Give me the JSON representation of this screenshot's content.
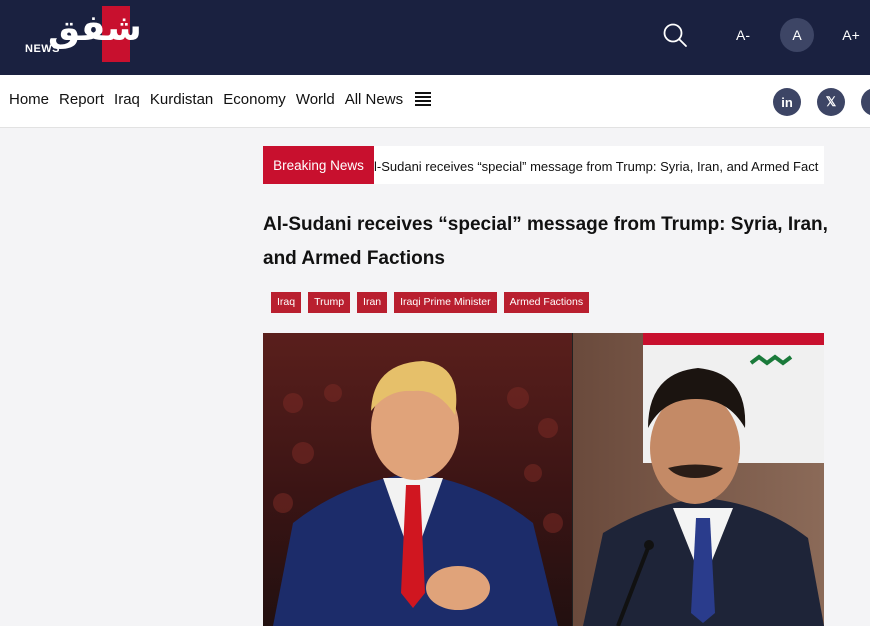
{
  "header": {
    "logo_text": "شفق",
    "logo_sub": "NEWS",
    "font_controls": [
      "A-",
      "A",
      "A+"
    ],
    "icons": {
      "search": "search-icon"
    }
  },
  "nav": {
    "items": [
      "Home",
      "Report",
      "Iraq",
      "Kurdistan",
      "Economy",
      "World",
      "All News"
    ],
    "menu_icon": "menu-icon",
    "social": [
      "in",
      "𝕏",
      "f"
    ]
  },
  "breaking": {
    "label": "Breaking News",
    "text": "l-Sudani receives “special” message from Trump: Syria, Iran, and Armed Fact"
  },
  "article": {
    "headline": "Al-Sudani receives “special” message from Trump: Syria, Iran, and Armed Factions",
    "tags": [
      "Iraq",
      "Trump",
      "Iran",
      "Iraqi Prime Minister",
      "Armed Factions"
    ]
  },
  "colors": {
    "header_bg": "#1a2140",
    "accent_red": "#c8102e",
    "tag_red": "#b91f2f",
    "circle_btn": "#3d4565"
  }
}
